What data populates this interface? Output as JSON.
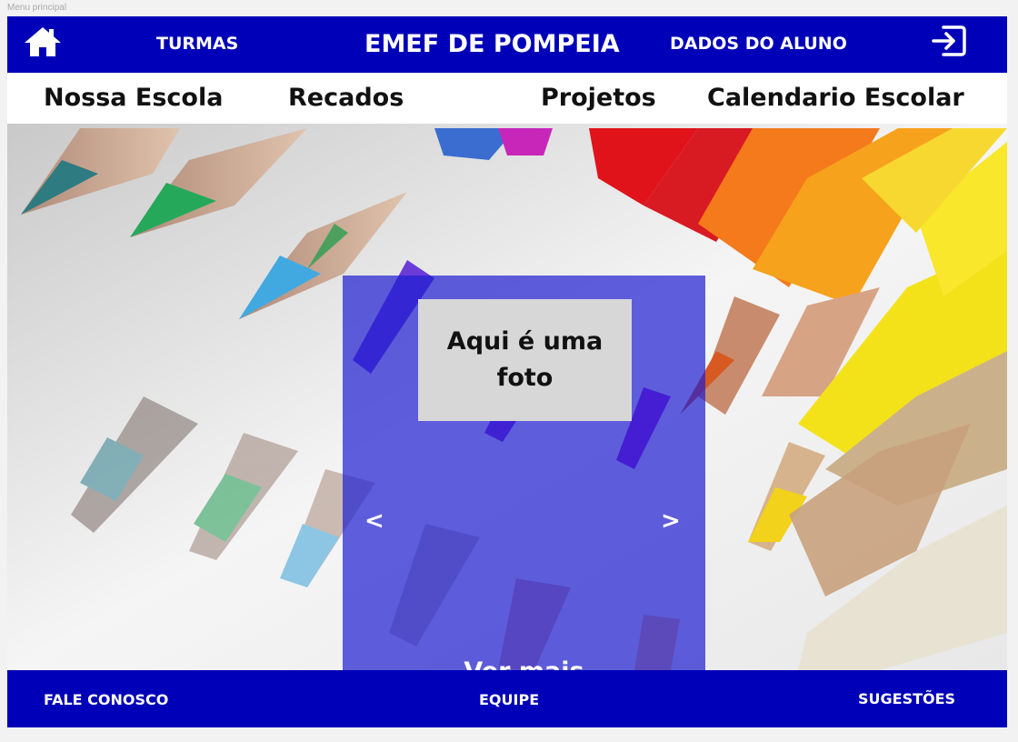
{
  "frame_label": "Menu principal",
  "topbar": {
    "home_icon": "home-icon",
    "turmas_label": "TURMAS",
    "school_title": "EMEF DE POMPEIA",
    "dados_label": "DADOS DO ALUNO",
    "exit_icon": "exit-icon"
  },
  "menu": {
    "items": [
      "Nossa Escola",
      "Recados",
      "Projetos",
      "Calendario Escolar"
    ]
  },
  "carousel": {
    "photo_text": "Aqui é uma foto",
    "prev": "<",
    "next": ">",
    "see_more": "Ver mais"
  },
  "footer": {
    "fale_conosco": "FALE CONOSCO",
    "equipe": "EQUIPE",
    "sugestoes": "SUGESTÕES"
  },
  "colors": {
    "brand_blue": "#0000b8",
    "overlay_blue": "#1e1ed2",
    "photo_box_gray": "#d7d7d7"
  }
}
